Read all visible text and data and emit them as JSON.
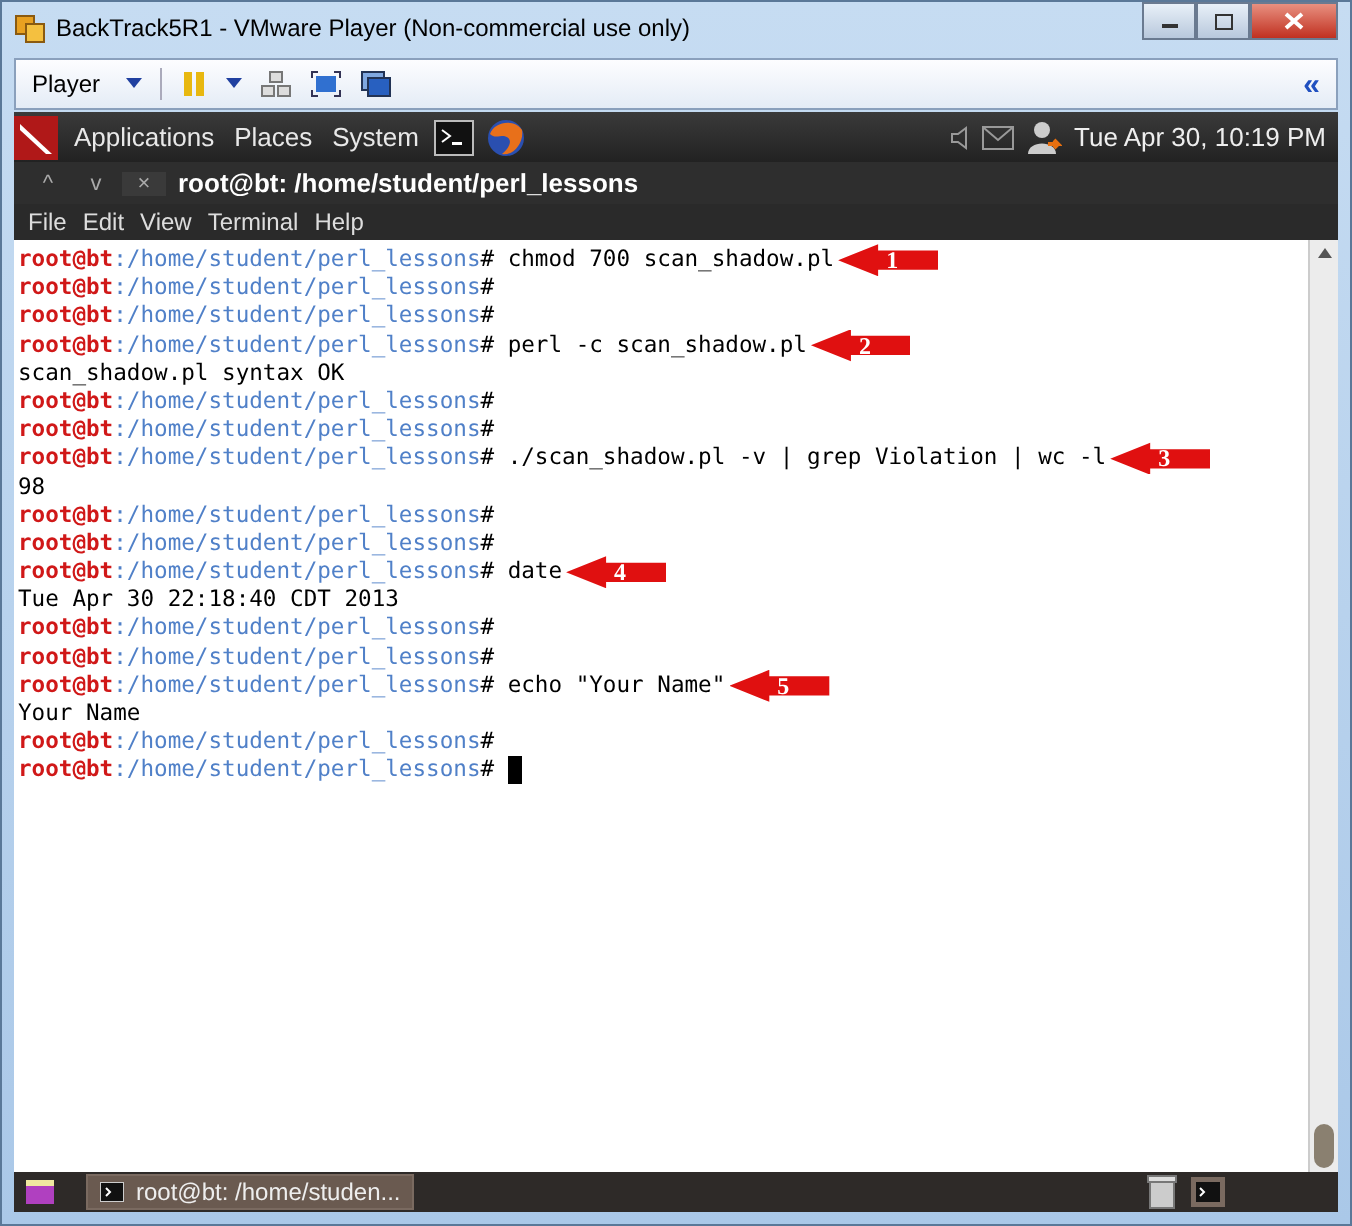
{
  "window": {
    "title": "BackTrack5R1 - VMware Player (Non-commercial use only)"
  },
  "vmware_toolbar": {
    "player_menu": "Player",
    "collapse": "«"
  },
  "top_panel": {
    "menus": [
      "Applications",
      "Places",
      "System"
    ],
    "clock": "Tue Apr 30, 10:19 PM"
  },
  "terminal": {
    "tab_title": "root@bt: /home/student/perl_lessons",
    "tab_nav": [
      "^",
      "v",
      "×"
    ],
    "menus": [
      "File",
      "Edit",
      "View",
      "Terminal",
      "Help"
    ],
    "lines": [
      {
        "kind": "prompt",
        "user": "root@bt",
        "path": ":/home/student/perl_lessons",
        "symbol": "#",
        "command": "chmod 700 scan_shadow.pl",
        "marker": "1"
      },
      {
        "kind": "prompt",
        "user": "root@bt",
        "path": ":/home/student/perl_lessons",
        "symbol": "#"
      },
      {
        "kind": "prompt",
        "user": "root@bt",
        "path": ":/home/student/perl_lessons",
        "symbol": "#"
      },
      {
        "kind": "prompt",
        "user": "root@bt",
        "path": ":/home/student/perl_lessons",
        "symbol": "#",
        "command": "perl -c scan_shadow.pl",
        "marker": "2"
      },
      {
        "kind": "output",
        "text": "scan_shadow.pl syntax OK"
      },
      {
        "kind": "prompt",
        "user": "root@bt",
        "path": ":/home/student/perl_lessons",
        "symbol": "#"
      },
      {
        "kind": "prompt",
        "user": "root@bt",
        "path": ":/home/student/perl_lessons",
        "symbol": "#"
      },
      {
        "kind": "prompt",
        "user": "root@bt",
        "path": ":/home/student/perl_lessons",
        "symbol": "#",
        "command": "./scan_shadow.pl -v | grep Violation | wc -l",
        "marker": "3"
      },
      {
        "kind": "output",
        "text": "98"
      },
      {
        "kind": "prompt",
        "user": "root@bt",
        "path": ":/home/student/perl_lessons",
        "symbol": "#"
      },
      {
        "kind": "prompt",
        "user": "root@bt",
        "path": ":/home/student/perl_lessons",
        "symbol": "#"
      },
      {
        "kind": "prompt",
        "user": "root@bt",
        "path": ":/home/student/perl_lessons",
        "symbol": "#",
        "command": "date",
        "marker": "4"
      },
      {
        "kind": "output",
        "text": "Tue Apr 30 22:18:40 CDT 2013"
      },
      {
        "kind": "prompt",
        "user": "root@bt",
        "path": ":/home/student/perl_lessons",
        "symbol": "#"
      },
      {
        "kind": "prompt",
        "user": "root@bt",
        "path": ":/home/student/perl_lessons",
        "symbol": "#"
      },
      {
        "kind": "prompt",
        "user": "root@bt",
        "path": ":/home/student/perl_lessons",
        "symbol": "#",
        "command": "echo \"Your Name\"",
        "marker": "5"
      },
      {
        "kind": "output",
        "text": "Your Name"
      },
      {
        "kind": "prompt",
        "user": "root@bt",
        "path": ":/home/student/perl_lessons",
        "symbol": "#"
      },
      {
        "kind": "prompt",
        "user": "root@bt",
        "path": ":/home/student/perl_lessons",
        "symbol": "#",
        "cursor": true
      }
    ]
  },
  "taskbar": {
    "window_button": "root@bt: /home/studen..."
  }
}
